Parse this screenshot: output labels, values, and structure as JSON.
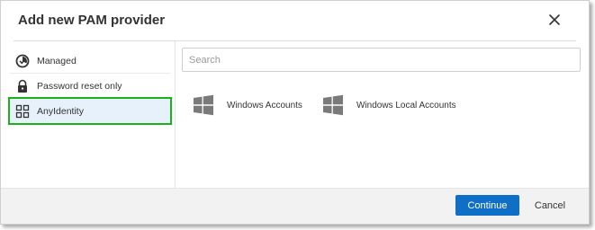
{
  "dialog": {
    "title": "Add new PAM provider",
    "close_icon": "close-icon"
  },
  "sidebar": {
    "items": [
      {
        "label": "Managed",
        "icon": "managed-icon",
        "selected": false
      },
      {
        "label": "Password reset only",
        "icon": "lock-icon",
        "selected": false
      },
      {
        "label": "AnyIdentity",
        "icon": "grid-icon",
        "selected": true
      }
    ]
  },
  "main": {
    "search": {
      "placeholder": "Search",
      "value": ""
    },
    "providers": [
      {
        "label": "Windows Accounts",
        "icon": "windows-icon"
      },
      {
        "label": "Windows Local Accounts",
        "icon": "windows-icon"
      }
    ]
  },
  "footer": {
    "continue_label": "Continue",
    "cancel_label": "Cancel"
  },
  "colors": {
    "accent": "#0f6fc6",
    "selection_outline": "#19b219",
    "selected_bg": "#e6f1fb"
  }
}
